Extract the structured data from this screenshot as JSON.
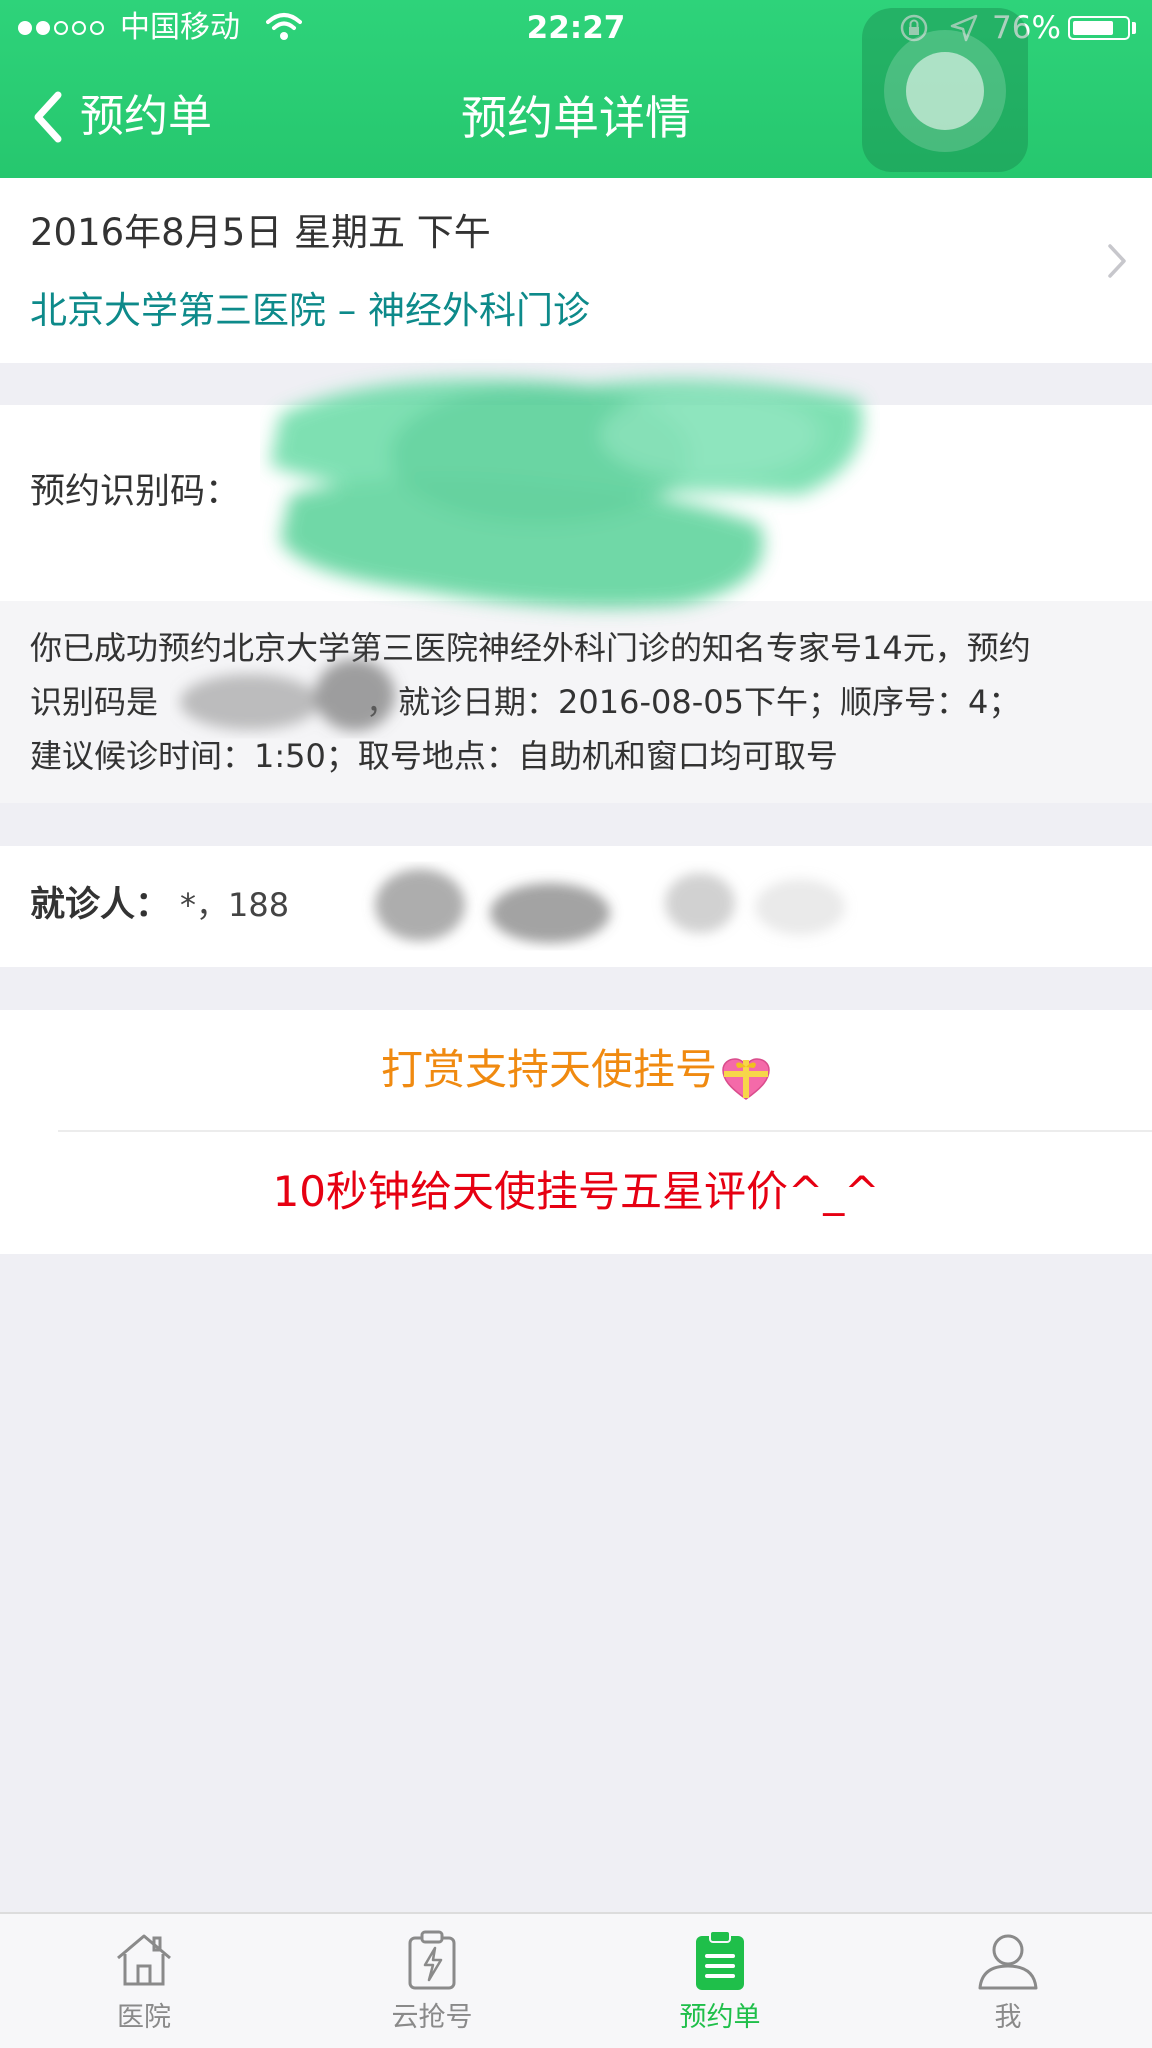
{
  "status_bar": {
    "carrier": "中国移动",
    "time": "22:27",
    "battery": "76%",
    "battery_level": 0.76
  },
  "nav": {
    "back_label": "预约单",
    "title": "预约单详情"
  },
  "appointment": {
    "date": "2016年8月5日 星期五 下午",
    "hospital": "北京大学第三医院 – 神经外科门诊"
  },
  "code_section": {
    "label": "预约识别码："
  },
  "notice": {
    "line1": "你已成功预约北京大学第三医院神经外科门诊的知名专家号14元，预约",
    "line2_prefix": "识别码是",
    "line2_suffix": "，就诊日期：2016-08-05下午；顺序号：4；",
    "line3": "建议候诊时间：1:50；取号地点：自助机和窗口均可取号"
  },
  "patient": {
    "label": "就诊人：",
    "value": "*，188"
  },
  "actions": {
    "reward": "打赏支持天使挂号",
    "rate": "10秒钟给天使挂号五星评价^_^"
  },
  "tabs": [
    {
      "label": "医院",
      "icon": "hospital-icon",
      "active": false
    },
    {
      "label": "云抢号",
      "icon": "flash-clipboard-icon",
      "active": false
    },
    {
      "label": "预约单",
      "icon": "order-list-icon",
      "active": true
    },
    {
      "label": "我",
      "icon": "person-icon",
      "active": false
    }
  ],
  "colors": {
    "header_green": "#2ed37a",
    "hospital_teal": "#0d8a8a",
    "reward_orange": "#f08a10",
    "rate_red": "#e60012",
    "tab_active_green": "#1fbf4a"
  }
}
